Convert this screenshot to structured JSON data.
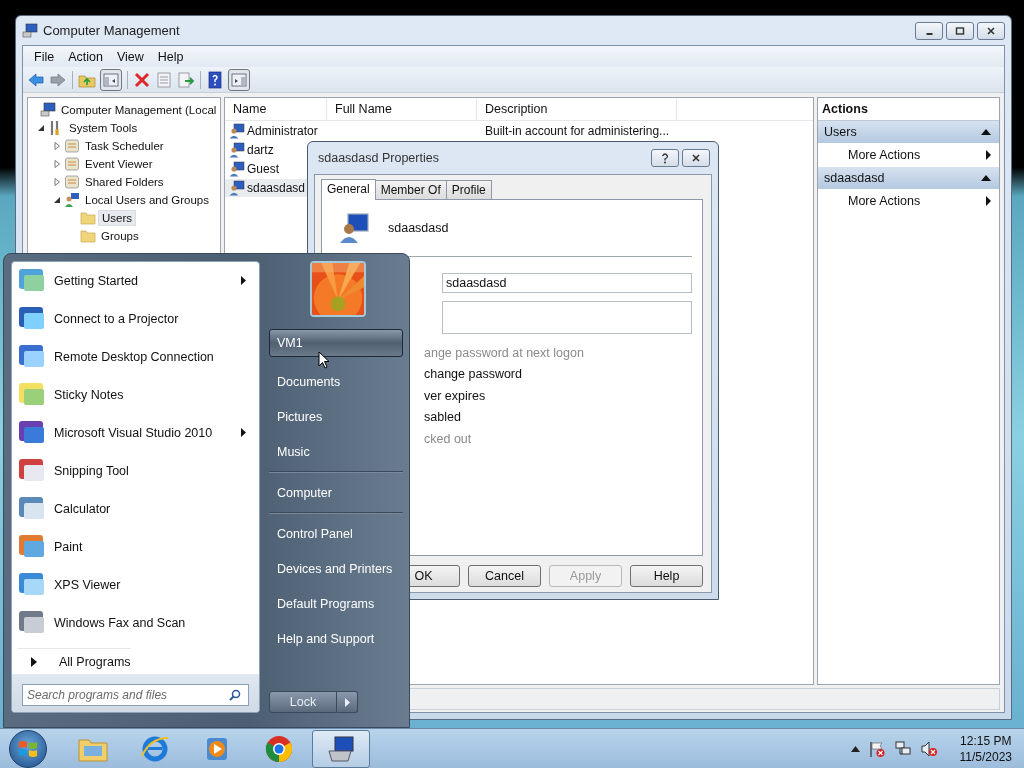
{
  "main_window": {
    "title": "Computer Management",
    "menu": [
      "File",
      "Action",
      "View",
      "Help"
    ],
    "tree": {
      "label": "Computer Management (Local",
      "children": [
        {
          "label": "System Tools",
          "expanded": true,
          "children": [
            {
              "label": "Task Scheduler",
              "expanded": false
            },
            {
              "label": "Event Viewer",
              "expanded": false
            },
            {
              "label": "Shared Folders",
              "expanded": false
            },
            {
              "label": "Local Users and Groups",
              "expanded": true,
              "children": [
                {
                  "label": "Users",
                  "selected": true
                },
                {
                  "label": "Groups",
                  "selected": false
                }
              ]
            }
          ]
        }
      ]
    },
    "list": {
      "columns": [
        "Name",
        "Full Name",
        "Description"
      ],
      "rows": [
        {
          "name": "Administrator",
          "description": "Built-in account for administering...",
          "selected": false
        },
        {
          "name": "dartz",
          "selected": false
        },
        {
          "name": "Guest",
          "selected": false
        },
        {
          "name": "sdaasdasd",
          "selected": true
        }
      ]
    },
    "actions": {
      "title": "Actions",
      "sections": [
        {
          "title": "Users",
          "items": [
            "More Actions"
          ]
        },
        {
          "title": "sdaasdasd",
          "items": [
            "More Actions"
          ]
        }
      ]
    }
  },
  "dialog": {
    "title": "sdaasdasd Properties",
    "tabs": [
      {
        "label": "General",
        "selected": true
      },
      {
        "label": "Member Of",
        "selected": false
      },
      {
        "label": "Profile",
        "selected": false
      }
    ],
    "user_name": "sdaasdasd",
    "full_name": {
      "value": "sdaasdasd"
    },
    "options": [
      {
        "label": "ange password at next logon",
        "disabled": true
      },
      {
        "label": "change password",
        "disabled": false
      },
      {
        "label": "ver expires",
        "disabled": false
      },
      {
        "label": "sabled",
        "disabled": false
      },
      {
        "label": "cked out",
        "disabled": true
      }
    ],
    "buttons": [
      {
        "label": "OK",
        "disabled": false
      },
      {
        "label": "Cancel",
        "disabled": false
      },
      {
        "label": "Apply",
        "disabled": true
      },
      {
        "label": "Help",
        "disabled": false
      }
    ]
  },
  "start_menu": {
    "programs": [
      {
        "label": "Getting Started",
        "submenu": true
      },
      {
        "label": "Connect to a Projector",
        "submenu": false
      },
      {
        "label": "Remote Desktop Connection",
        "submenu": false
      },
      {
        "label": "Sticky Notes",
        "submenu": false
      },
      {
        "label": "Microsoft Visual Studio 2010",
        "submenu": true
      },
      {
        "label": "Snipping Tool",
        "submenu": false
      },
      {
        "label": "Calculator",
        "submenu": false
      },
      {
        "label": "Paint",
        "submenu": false
      },
      {
        "label": "XPS Viewer",
        "submenu": false
      },
      {
        "label": "Windows Fax and Scan",
        "submenu": false
      }
    ],
    "all_programs": "All Programs",
    "search": {
      "placeholder": "Search programs and files"
    },
    "places": [
      {
        "label": "VM1",
        "selected": true,
        "separator_after": false
      },
      {
        "label": "Documents",
        "selected": false,
        "separator_after": false
      },
      {
        "label": "Pictures",
        "selected": false,
        "separator_after": false
      },
      {
        "label": "Music",
        "selected": false,
        "separator_after": true
      },
      {
        "label": "Computer",
        "selected": false,
        "separator_after": true
      },
      {
        "label": "Control Panel",
        "selected": false,
        "separator_after": false
      },
      {
        "label": "Devices and Printers",
        "selected": false,
        "separator_after": false
      },
      {
        "label": "Default Programs",
        "selected": false,
        "separator_after": false
      },
      {
        "label": "Help and Support",
        "selected": false,
        "separator_after": false
      }
    ],
    "lock": "Lock"
  },
  "taskbar": {
    "buttons": [
      {
        "kind": "explorer",
        "active": false
      },
      {
        "kind": "ie",
        "active": false
      },
      {
        "kind": "media",
        "active": false
      },
      {
        "kind": "chrome",
        "active": false
      },
      {
        "kind": "mmc",
        "active": true
      }
    ],
    "clock": {
      "time": "12:15 PM",
      "date": "11/5/2023"
    }
  }
}
